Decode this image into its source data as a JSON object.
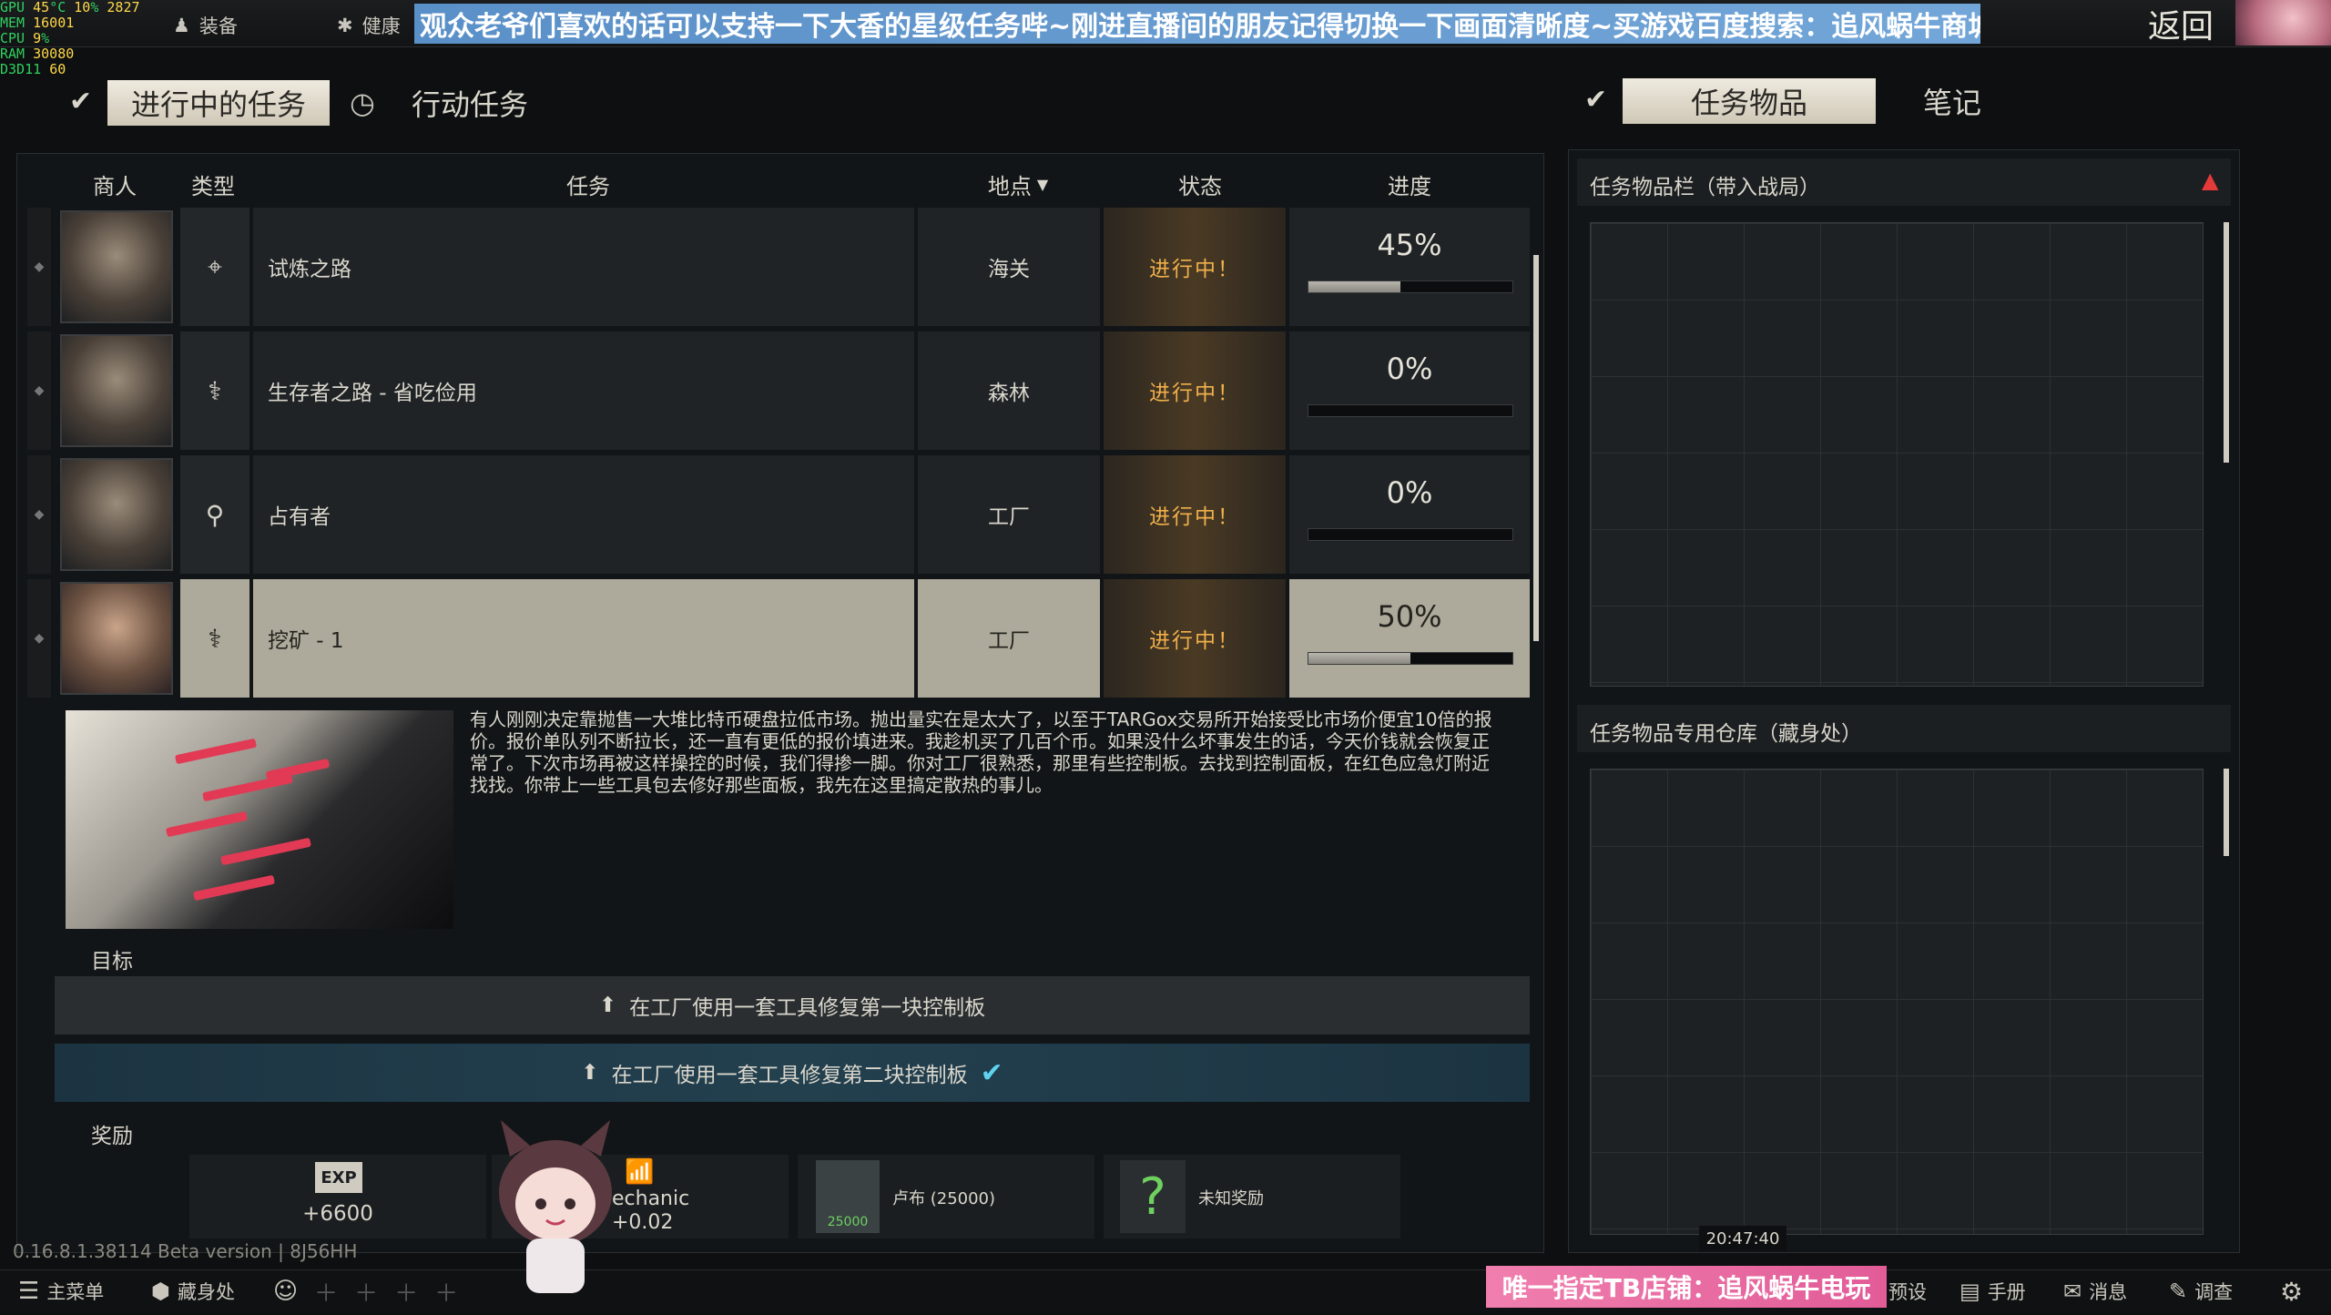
{
  "overlay": {
    "gpu_label": "GPU",
    "gpu_temp": "45",
    "gpu_load": "10",
    "gpu_clock": "2827",
    "mem_label": "MEM",
    "mem_value": "16001",
    "cpu_label": "CPU",
    "cpu_value": "9",
    "ram_label": "RAM",
    "ram_value": "30080",
    "api_label": "D3D11",
    "fps": "60"
  },
  "topnav": {
    "gear_label": "装备",
    "health_label": "健康",
    "back_label": "返回"
  },
  "stream_banner": "观众老爷们喜欢的话可以支持一下大香的星级任务哔~刚进直播间的朋友记得切换一下画面清晰度~买游戏百度搜索：追风蜗牛商城",
  "tabs": {
    "active_quests": "进行中的任务",
    "operation_tasks": "行动任务",
    "quest_items": "任务物品",
    "notes": "笔记"
  },
  "table": {
    "headers": {
      "trader": "商人",
      "type": "类型",
      "quest": "任务",
      "location": "地点",
      "status": "状态",
      "progress": "进度"
    },
    "rows": [
      {
        "type_icon": "crosshair-icon",
        "name": "试炼之路",
        "location": "海关",
        "status": "进行中！",
        "progress_text": "45%",
        "progress": 0.45
      },
      {
        "type_icon": "survivor-icon",
        "name": "生存者之路 - 省吃俭用",
        "location": "森林",
        "status": "进行中！",
        "progress_text": "0%",
        "progress": 0
      },
      {
        "type_icon": "location-pin-icon",
        "name": "占有者",
        "location": "工厂",
        "status": "进行中！",
        "progress_text": "0%",
        "progress": 0
      },
      {
        "type_icon": "survivor-icon",
        "name": "挖矿 - 1",
        "location": "工厂",
        "status": "进行中！",
        "progress_text": "50%",
        "progress": 0.5
      }
    ]
  },
  "detail": {
    "description": "有人刚刚决定靠抛售一大堆比特币硬盘拉低市场。抛出量实在是太大了，以至于TARGox交易所开始接受比市场价便宜10倍的报价。报价单队列不断拉长，还一直有更低的报价填进来。我趁机买了几百个币。如果没什么坏事发生的话，今天价钱就会恢复正常了。下次市场再被这样操控的时候，我们得掺一脚。你对工厂很熟悉，那里有些控制板。去找到控制面板，在红色应急灯附近找找。你带上一些工具包去修好那些面板，我先在这里搞定散热的事儿。",
    "objectives_label": "目标",
    "objectives": [
      {
        "text": "在工厂使用一套工具修复第一块控制板"
      },
      {
        "text": "在工厂使用一套工具修复第二块控制板"
      }
    ],
    "rewards_label": "奖励",
    "rewards": {
      "exp_badge": "EXP",
      "exp_value": "+6600",
      "mechanic_label": "echanic",
      "mechanic_value": "+0.02",
      "roubles_label": "卢布 (25000)",
      "roubles_amount": "25000",
      "unknown_label": "未知奖励",
      "unknown_glyph": "?"
    }
  },
  "right_panel": {
    "quest_items_title": "任务物品栏（带入战局）",
    "stash_title": "任务物品专用仓库（藏身处）",
    "timestamp": "20:47:40"
  },
  "version": "0.16.8.1.38114 Beta version | 8J56HH",
  "bottombar": {
    "main_menu": "主菜单",
    "hideout": "藏身处",
    "presets": "预设",
    "handbook": "手册",
    "messages": "消息",
    "survey": "调查"
  },
  "shop_banner": "唯一指定TB店铺：追风蜗牛电玩",
  "colors": {
    "accent": "#f0b04a",
    "banner_blue": "#5a90c8",
    "banner_pink": "#e25c98"
  }
}
